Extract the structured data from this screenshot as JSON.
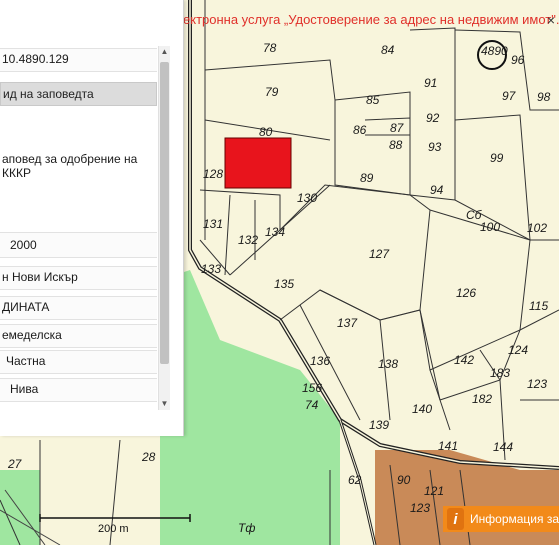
{
  "banner": {
    "text": "ектронна услуга „Удостоверение за адрес на недвижим имот\".",
    "close_label": "×"
  },
  "panel": {
    "rows": [
      {
        "text": "10.4890.129"
      },
      {
        "text": "ид на заповедта"
      },
      {
        "text": "аповед за одобрение на КККР"
      },
      {
        "text": "2000"
      },
      {
        "text": "н Нови Искър"
      },
      {
        "text": "ДИНАТА"
      },
      {
        "text": "емеделска"
      },
      {
        "text": "Частна"
      },
      {
        "text": "Нива"
      }
    ]
  },
  "map": {
    "parcels": [
      "78",
      "84",
      "91",
      "4890",
      "96",
      "79",
      "85",
      "97",
      "98",
      "80",
      "86",
      "87",
      "92",
      "128",
      "88",
      "93",
      "99",
      "89",
      "94",
      "130",
      "131",
      "132",
      "134",
      "100",
      "102",
      "133",
      "127",
      "135",
      "126",
      "115",
      "137",
      "136",
      "138",
      "142",
      "124",
      "156",
      "74",
      "183",
      "123",
      "139",
      "140",
      "182",
      "141",
      "144",
      "27",
      "28",
      "62",
      "90",
      "121",
      "123"
    ],
    "street_label": "Сб",
    "scale_text": "200 m",
    "road_label": "Тф"
  },
  "info_button": {
    "label": "Информация за",
    "icon_glyph": "i"
  },
  "colors": {
    "selected_parcel": "#e8141c",
    "orange_zone": "#c98a58",
    "green_zone": "#9fe6a0",
    "accent": "#f28a1a"
  }
}
